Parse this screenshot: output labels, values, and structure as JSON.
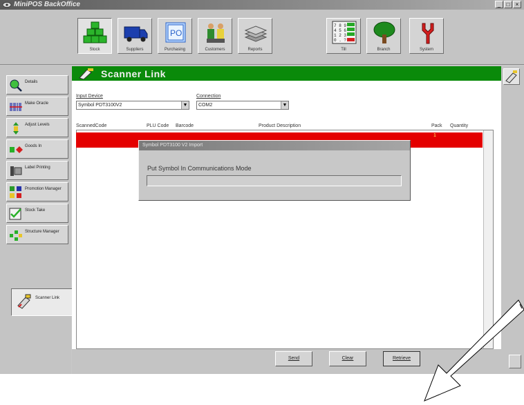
{
  "window": {
    "title": "MiniPOS BackOffice",
    "controls": [
      "_",
      "□",
      "×"
    ]
  },
  "toolbar": {
    "items": [
      {
        "label": "Stock",
        "icon": "stock-boxes-icon",
        "active": true
      },
      {
        "label": "Suppliers",
        "icon": "delivery-truck-icon",
        "active": false
      },
      {
        "label": "Purchasing",
        "icon": "purchase-order-icon",
        "active": false
      },
      {
        "label": "Customers",
        "icon": "customers-icon",
        "active": false
      },
      {
        "label": "Reports",
        "icon": "reports-stack-icon",
        "active": false
      },
      {
        "label": "Till",
        "icon": "till-keypad-icon",
        "active": false
      },
      {
        "label": "Branch",
        "icon": "tree-icon",
        "active": false
      },
      {
        "label": "System",
        "icon": "tools-icon",
        "active": false
      }
    ]
  },
  "sidebar": {
    "items": [
      {
        "label": "Details",
        "icon": "magnifier-icon"
      },
      {
        "label": "Make Oracle",
        "icon": "barcode-icon"
      },
      {
        "label": "Adjust Levels",
        "icon": "adjust-levels-icon"
      },
      {
        "label": "Goods In",
        "icon": "goods-in-icon"
      },
      {
        "label": "Label Printing",
        "icon": "label-printer-icon"
      },
      {
        "label": "Promotion Manager",
        "icon": "promotion-icon"
      },
      {
        "label": "Stock Take",
        "icon": "checklist-icon"
      },
      {
        "label": "Structure Manager",
        "icon": "structure-icon"
      },
      {
        "label": "Scanner Link",
        "icon": "scanner-icon",
        "active": true
      }
    ]
  },
  "panel": {
    "title": "Scanner Link",
    "input_device_label": "Input Device",
    "input_device_value": "Symbol PDT3100V2",
    "connection_label": "Connection",
    "connection_value": "COM2",
    "columns": [
      "ScannedCode",
      "PLU Code",
      "Barcode",
      "Product Description",
      "Pack",
      "Quantity"
    ],
    "row_quantity": "1"
  },
  "dialog": {
    "title": "Symbol PDT3100 V2 Import",
    "message": "Put Symbol In Communications Mode"
  },
  "buttons": {
    "send": "Send",
    "clear": "Clear",
    "retrieve": "Retrieve"
  },
  "colors": {
    "header_green": "#0a8a0a",
    "selected_row_red": "#e40000",
    "window_grey": "#c8c8c8"
  }
}
